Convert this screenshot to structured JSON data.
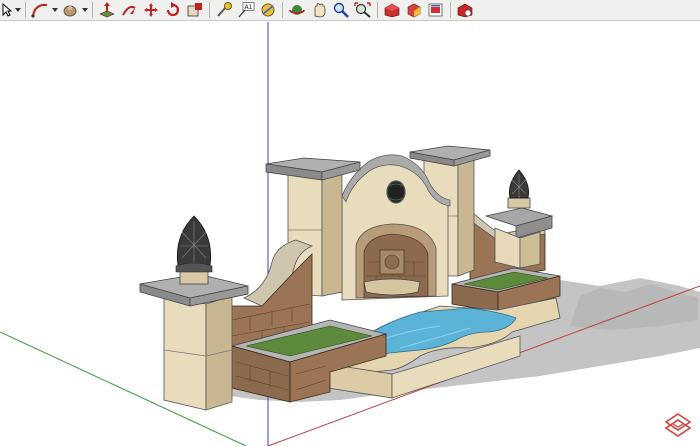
{
  "toolbar": {
    "tools": [
      {
        "name": "select-tool"
      },
      {
        "name": "arc-tool"
      },
      {
        "name": "paint-bucket-tool"
      },
      {
        "name": "push-pull-tool"
      },
      {
        "name": "follow-me-tool"
      },
      {
        "name": "move-tool"
      },
      {
        "name": "rotate-tool"
      },
      {
        "name": "scale-tool"
      },
      {
        "name": "tape-measure-tool"
      },
      {
        "name": "text-tool"
      },
      {
        "name": "axes-tool"
      },
      {
        "name": "orbit-tool"
      },
      {
        "name": "pan-tool"
      },
      {
        "name": "zoom-tool"
      },
      {
        "name": "zoom-extents-tool"
      },
      {
        "name": "warehouse-tool"
      },
      {
        "name": "components-tool"
      },
      {
        "name": "share-model-tool"
      },
      {
        "name": "extension-tool"
      }
    ],
    "text_tool_glyph": "A1"
  },
  "colors": {
    "axis_blue": "#3b3bd0",
    "axis_red": "#c04040",
    "axis_green": "#3a9a3a",
    "stone": "#e6d8b8",
    "stone_shadow": "#c9b791",
    "cap": "#9e9e9e",
    "brick": "#9b7355",
    "water": "#5bb4d8",
    "grass": "#5d8a3c",
    "shadow": "#c2c2c2",
    "watermark": "#d44040"
  }
}
